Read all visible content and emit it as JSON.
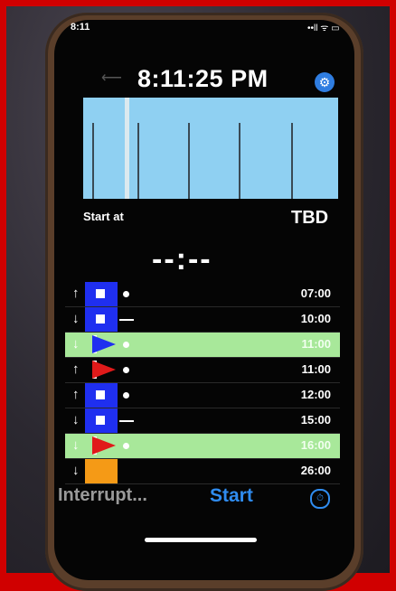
{
  "status": {
    "time": "8:11",
    "indicators": "••ll ᯤ ▭"
  },
  "header": {
    "back_icon": "back-icon",
    "clock": "8:11:25 PM",
    "settings_icon": "settings-icon"
  },
  "start": {
    "label": "Start at",
    "value": "TBD",
    "countdown": "--:--"
  },
  "sequence": [
    {
      "arrow": "↑",
      "flag": "blue-square",
      "mark": "dot",
      "time": "07:00",
      "highlight": false
    },
    {
      "arrow": "↓",
      "flag": "blue-square",
      "mark": "line",
      "time": "10:00",
      "highlight": false
    },
    {
      "arrow": "↓",
      "flag": "blue-pennant",
      "mark": "dot",
      "time": "11:00",
      "highlight": true
    },
    {
      "arrow": "↑",
      "flag": "red-pennant",
      "mark": "dot",
      "time": "11:00",
      "highlight": false
    },
    {
      "arrow": "↑",
      "flag": "blue-square",
      "mark": "dot",
      "time": "12:00",
      "highlight": false
    },
    {
      "arrow": "↓",
      "flag": "blue-square",
      "mark": "line",
      "time": "15:00",
      "highlight": false
    },
    {
      "arrow": "↓",
      "flag": "red-pennant",
      "mark": "dot",
      "time": "16:00",
      "highlight": true
    },
    {
      "arrow": "↓",
      "flag": "orange",
      "mark": "none",
      "time": "26:00",
      "highlight": false
    }
  ],
  "footer": {
    "interrupt": "Interrupt...",
    "start": "Start",
    "timer_icon": "timer-icon"
  },
  "colors": {
    "accent": "#2f8cf0",
    "highlight": "#a8e89a",
    "sky": "#8fd0f2",
    "flag_blue": "#1f2ff0",
    "flag_orange": "#f59a16",
    "flag_red": "#e01a1a"
  }
}
